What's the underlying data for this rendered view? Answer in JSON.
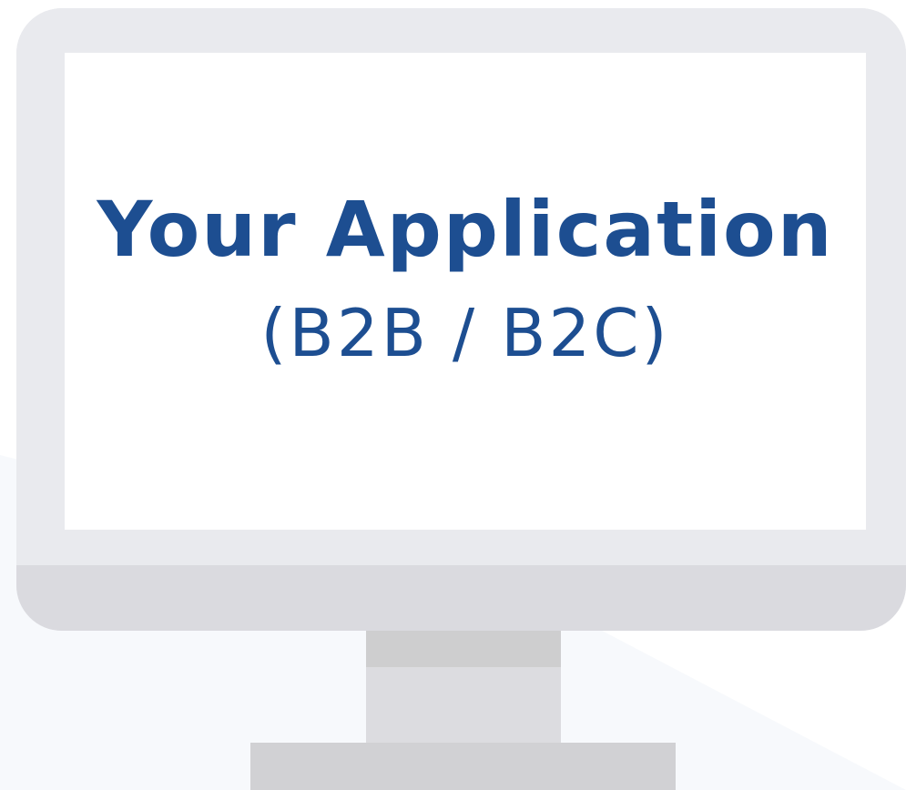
{
  "screen": {
    "title": "Your Application",
    "subtitle": "(B2B / B2C)"
  },
  "colors": {
    "accent": "#1d4e91",
    "bezel": "#e9eaee",
    "chin": "#dadadf",
    "stand": "#d1d1d4",
    "background_wedge": "#f7f9fc"
  }
}
